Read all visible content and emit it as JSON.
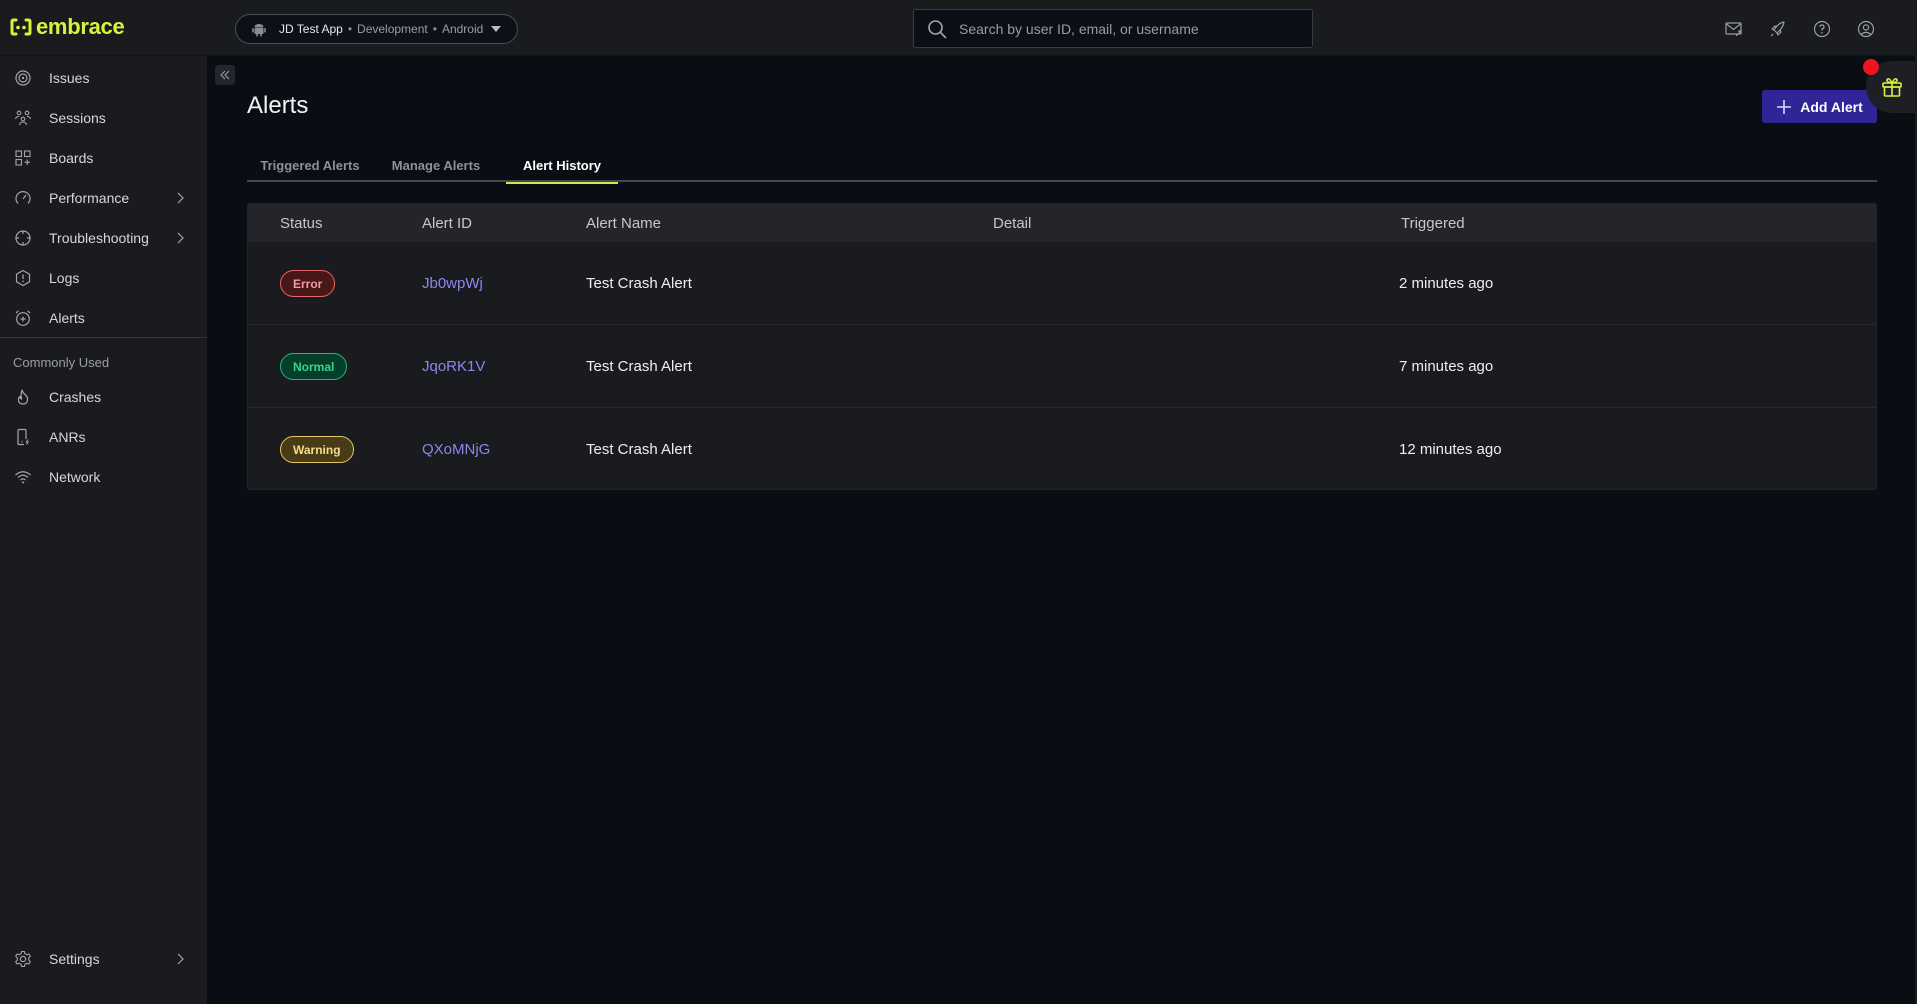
{
  "brand": {
    "name": "embrace",
    "accent": "#d7f33c"
  },
  "app_selector": {
    "app_name": "JD Test App",
    "environment": "Development",
    "platform": "Android",
    "separator": "•"
  },
  "search": {
    "placeholder": "Search by user ID, email, or username",
    "value": ""
  },
  "top_icons": [
    "mail-forward-icon",
    "rocket-icon",
    "help-icon",
    "user-account-icon"
  ],
  "sidebar": {
    "items": [
      {
        "label": "Issues",
        "icon": "radar-icon",
        "has_submenu": false
      },
      {
        "label": "Sessions",
        "icon": "users-icon",
        "has_submenu": false
      },
      {
        "label": "Boards",
        "icon": "boards-icon",
        "has_submenu": false
      },
      {
        "label": "Performance",
        "icon": "gauge-icon",
        "has_submenu": true
      },
      {
        "label": "Troubleshooting",
        "icon": "crosshair-icon",
        "has_submenu": true
      },
      {
        "label": "Logs",
        "icon": "hexagon-alert-icon",
        "has_submenu": false
      },
      {
        "label": "Alerts",
        "icon": "alarm-icon",
        "has_submenu": false
      }
    ],
    "section_label": "Commonly Used",
    "common_items": [
      {
        "label": "Crashes",
        "icon": "flame-icon"
      },
      {
        "label": "ANRs",
        "icon": "phone-bolt-icon"
      },
      {
        "label": "Network",
        "icon": "wifi-icon"
      }
    ],
    "settings": {
      "label": "Settings",
      "icon": "gear-icon",
      "has_submenu": true
    }
  },
  "page": {
    "title": "Alerts",
    "add_button_label": "Add Alert",
    "tabs": [
      {
        "label": "Triggered Alerts",
        "active": false
      },
      {
        "label": "Manage Alerts",
        "active": false
      },
      {
        "label": "Alert History",
        "active": true
      }
    ]
  },
  "table": {
    "columns": [
      "Status",
      "Alert ID",
      "Alert Name",
      "Detail",
      "Triggered"
    ],
    "rows": [
      {
        "status": "Error",
        "status_type": "error",
        "alert_id": "Jb0wpWj",
        "alert_name": "Test Crash Alert",
        "detail": "",
        "triggered": "2 minutes ago"
      },
      {
        "status": "Normal",
        "status_type": "normal",
        "alert_id": "JqoRK1V",
        "alert_name": "Test Crash Alert",
        "detail": "",
        "triggered": "7 minutes ago"
      },
      {
        "status": "Warning",
        "status_type": "warning",
        "alert_id": "QXoMNjG",
        "alert_name": "Test Crash Alert",
        "detail": "",
        "triggered": "12 minutes ago"
      }
    ]
  },
  "colors": {
    "error": "#e5676b",
    "normal": "#1fb97a",
    "warning": "#e4c565",
    "link": "#8c87ec",
    "primary_button": "#2f2597",
    "active_tab_underline": "#c6ef4a",
    "notification_dot": "#f0141e"
  }
}
